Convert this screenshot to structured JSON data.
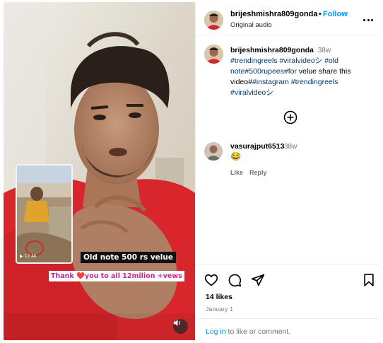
{
  "header": {
    "username": "brijeshmishra809gonda",
    "separator": "•",
    "follow_label": "Follow",
    "subtitle": "Original audio"
  },
  "caption": {
    "username": "brijeshmishra809gonda",
    "time": "38w",
    "line1": "#trendingreels #viralvideoシ #old",
    "line2a": "note#500rupees#for",
    "line2b": " velue share this",
    "line3a": "video#",
    "line3b": "#instagram #trendingreels",
    "line4": "#viralvideoシ"
  },
  "comment": {
    "username": "vasurajput6513",
    "time": "38w",
    "text": "😂",
    "like_label": "Like",
    "reply_label": "Reply"
  },
  "media": {
    "overlay_caption": "Old note 500 rs velue",
    "thanks_prefix": "Thank ",
    "thanks_heart": "❤️",
    "thanks_suffix": "you to all 12milion +vews",
    "pip_views": "▶ 12.4K"
  },
  "stats": {
    "likes": "14 likes",
    "date": "January 1"
  },
  "login": {
    "link": "Log in",
    "rest": " to like or comment."
  },
  "icons": {
    "like": "heart-icon",
    "comment": "comment-icon",
    "share": "share-icon",
    "save": "bookmark-icon",
    "more": "more-icon",
    "add_comment": "plus-circle-icon",
    "audio": "speaker-icon"
  },
  "colors": {
    "link_blue": "#0095f6",
    "tag_blue": "#00376b",
    "muted": "#737373",
    "thanks_pink": "#c42a8d"
  }
}
